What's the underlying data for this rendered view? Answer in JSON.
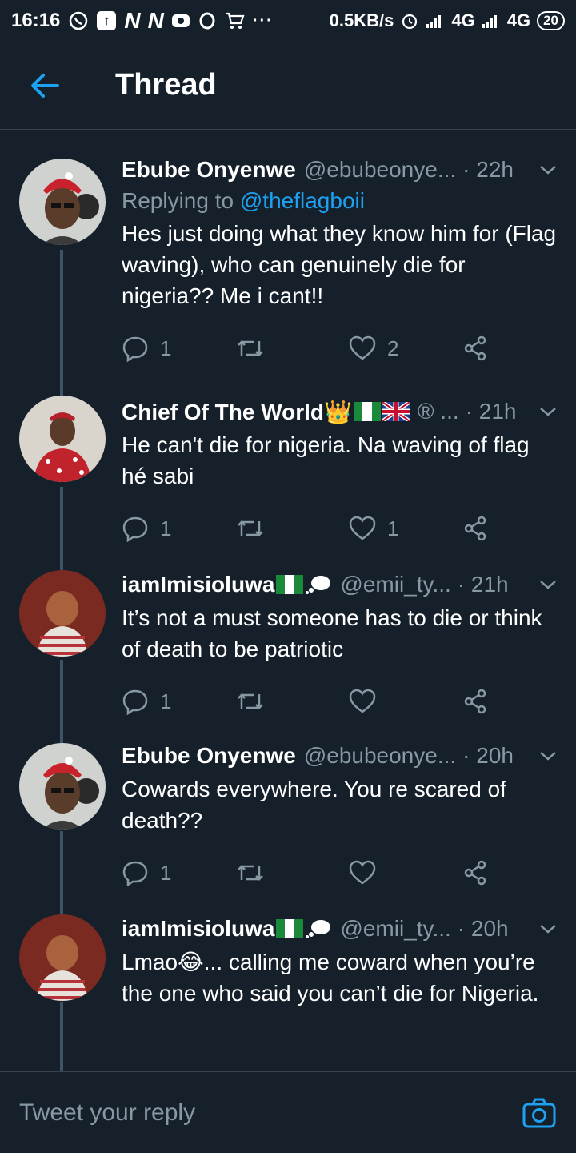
{
  "status_bar": {
    "time": "16:16",
    "speed": "0.5KB/s",
    "network_1": "4G",
    "network_2": "4G",
    "battery": "20"
  },
  "header": {
    "title": "Thread"
  },
  "tweets": [
    {
      "author": "Ebube Onyenwe",
      "handle": "@ebubeonye...",
      "time": "· 22h",
      "replying_prefix": "Replying to ",
      "replying_to": "@theflagboii",
      "text": "Hes just doing what they know him for (Flag waving), who can genuinely die for nigeria?? Me i cant!!",
      "reply_count": "1",
      "retweet_count": "",
      "like_count": "2"
    },
    {
      "author": "Chief Of The World👑",
      "handle": "® ...",
      "time": "· 21h",
      "text": "He can't die for nigeria. Na waving of flag hé sabi",
      "reply_count": "1",
      "retweet_count": "",
      "like_count": "1"
    },
    {
      "author": "iamImisioluwa",
      "handle": "@emii_ty...",
      "time": "· 21h",
      "text": "It’s not a must someone has to die or think of death to be patriotic",
      "reply_count": "1",
      "retweet_count": "",
      "like_count": ""
    },
    {
      "author": "Ebube Onyenwe",
      "handle": "@ebubeonye...",
      "time": "· 20h",
      "text": "Cowards everywhere. You re scared of death??",
      "reply_count": "1",
      "retweet_count": "",
      "like_count": ""
    },
    {
      "author": "iamImisioluwa",
      "handle": "@emii_ty...",
      "time": "· 20h",
      "text": "Lmao😂... calling me coward when you’re the one who said you can’t die for Nigeria.",
      "reply_count": "",
      "retweet_count": "",
      "like_count": ""
    }
  ],
  "compose": {
    "placeholder": "Tweet your reply"
  },
  "colors": {
    "background": "#15202b",
    "accent": "#1da1f2",
    "muted": "#8899a6",
    "divider": "#38444d"
  }
}
